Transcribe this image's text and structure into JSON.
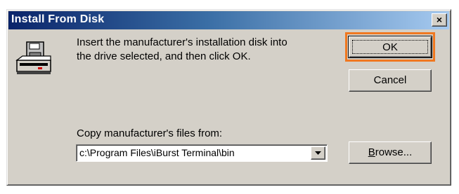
{
  "dialog": {
    "title": "Install From Disk",
    "close_label": "×",
    "message_line1": "Insert the manufacturer's installation disk into",
    "message_line2": "the drive selected, and then click OK.",
    "copy_label": "Copy manufacturer's files from:",
    "path_value": "c:\\Program Files\\iBurst Terminal\\bin",
    "buttons": {
      "ok": "OK",
      "cancel": "Cancel",
      "browse_underlined": "B",
      "browse_rest": "rowse..."
    }
  },
  "icons": {
    "disk_drive": "disk-drive-icon",
    "close": "close-icon",
    "dropdown": "chevron-down-icon"
  },
  "colors": {
    "titlebar_start": "#0a246a",
    "titlebar_end": "#a6caf0",
    "face": "#d4d0c8",
    "highlight_outline": "#f07820"
  }
}
